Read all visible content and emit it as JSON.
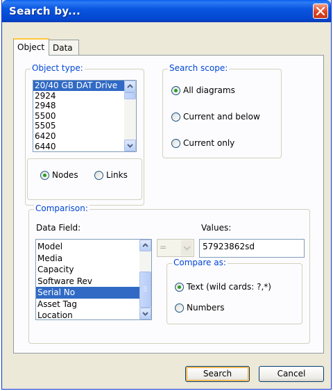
{
  "window": {
    "title": "Search by..."
  },
  "tabs": [
    {
      "label": "Object"
    },
    {
      "label": "Data"
    }
  ],
  "object_type": {
    "legend": "Object type:",
    "items": [
      "20/40 GB DAT Drive",
      "2924",
      "2948",
      "5500",
      "5505",
      "6420",
      "6440"
    ],
    "selected_index": 0
  },
  "element_kind": {
    "nodes_label": "Nodes",
    "links_label": "Links",
    "selected": "Nodes"
  },
  "search_scope": {
    "legend": "Search scope:",
    "options": [
      "All diagrams",
      "Current and below",
      "Current only"
    ],
    "selected": "All diagrams"
  },
  "comparison": {
    "legend": "Comparison:",
    "data_field_label": "Data Field:",
    "fields": [
      "Model",
      "Media",
      "Capacity",
      "Software Rev",
      "Serial No",
      "Asset Tag",
      "Location"
    ],
    "selected_index": 4,
    "operator": "=",
    "values_label": "Values:",
    "value": "57923862sd",
    "compare_as": {
      "legend": "Compare as:",
      "options": [
        "Text (wild cards: ?,*)",
        "Numbers"
      ],
      "selected": "Text (wild cards: ?,*)"
    }
  },
  "buttons": {
    "search": "Search",
    "cancel": "Cancel"
  },
  "colors": {
    "title_bar": "#0a56e0",
    "legend_text": "#0046d5",
    "selection": "#316ac5",
    "radio_dot": "#21a121"
  }
}
